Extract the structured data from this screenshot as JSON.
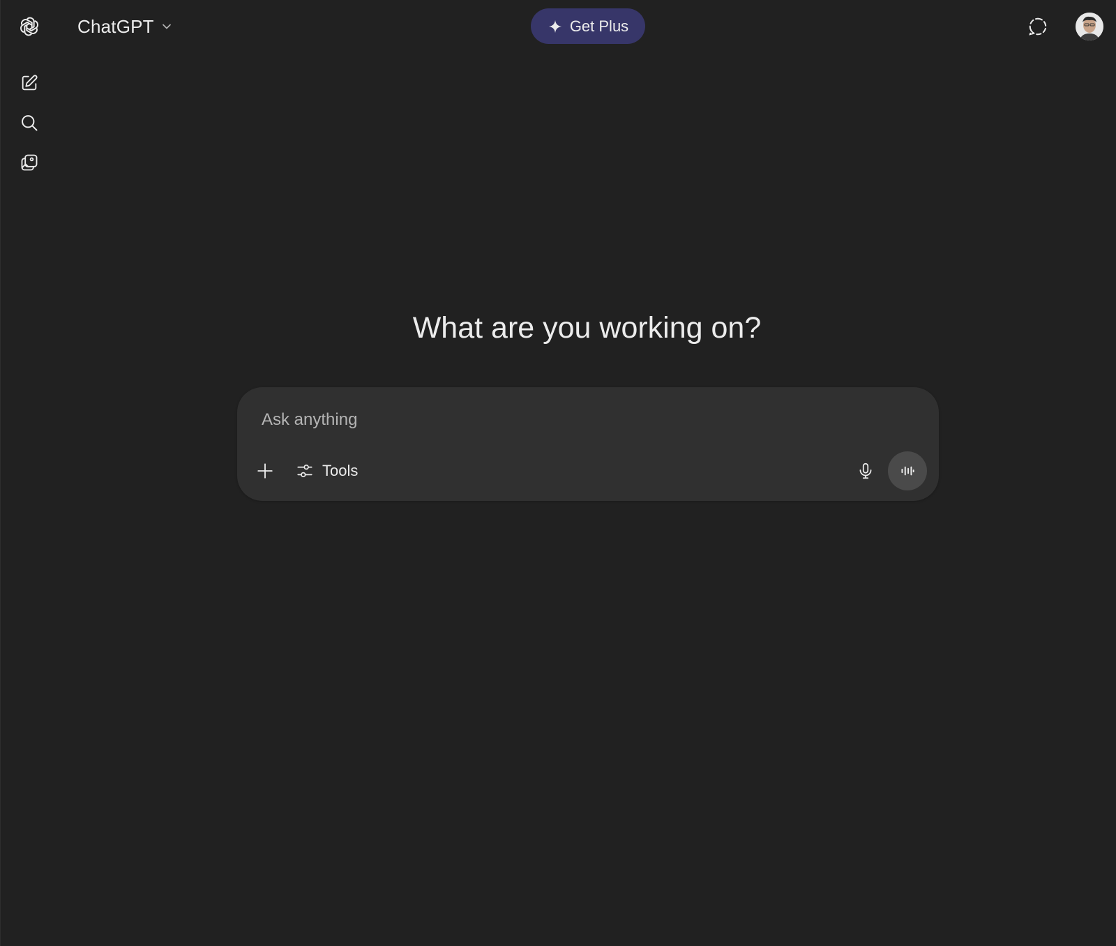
{
  "header": {
    "model_name": "ChatGPT",
    "get_plus_label": "Get Plus"
  },
  "sidebar": {
    "items": [
      {
        "icon": "openai-logo-icon"
      },
      {
        "icon": "new-chat-icon"
      },
      {
        "icon": "search-icon"
      },
      {
        "icon": "library-icon"
      }
    ]
  },
  "main": {
    "heading": "What are you working on?"
  },
  "composer": {
    "placeholder": "Ask anything",
    "value": "",
    "tools_label": "Tools"
  },
  "colors": {
    "background": "#212121",
    "composer": "#303030",
    "get_plus_bg": "#373669",
    "voice_button": "#4a4a4a",
    "text": "#ececec"
  }
}
